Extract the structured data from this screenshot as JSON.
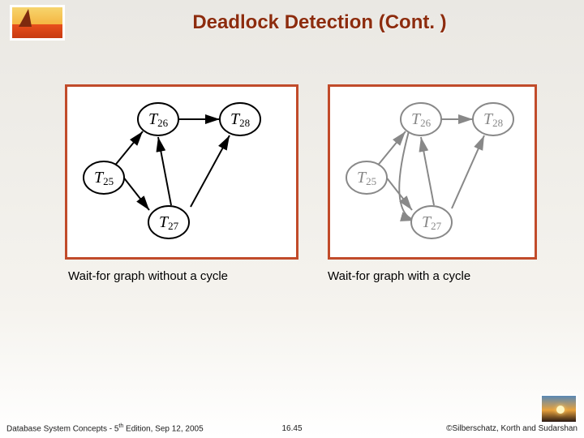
{
  "title": "Deadlock Detection (Cont. )",
  "diagrams": {
    "left": {
      "nodes": {
        "t25": "T25",
        "t26": "T26",
        "t27": "T27",
        "t28": "T28"
      },
      "caption": "Wait-for graph without a cycle"
    },
    "right": {
      "nodes": {
        "t25": "T25",
        "t26": "T26",
        "t27": "T27",
        "t28": "T28"
      },
      "caption": "Wait-for graph with a cycle"
    }
  },
  "footer": {
    "left_a": "Database System Concepts - 5",
    "left_sup": "th",
    "left_b": " Edition, Sep 12, 2005",
    "mid": "16.45",
    "right": "©Silberschatz, Korth and Sudarshan"
  }
}
